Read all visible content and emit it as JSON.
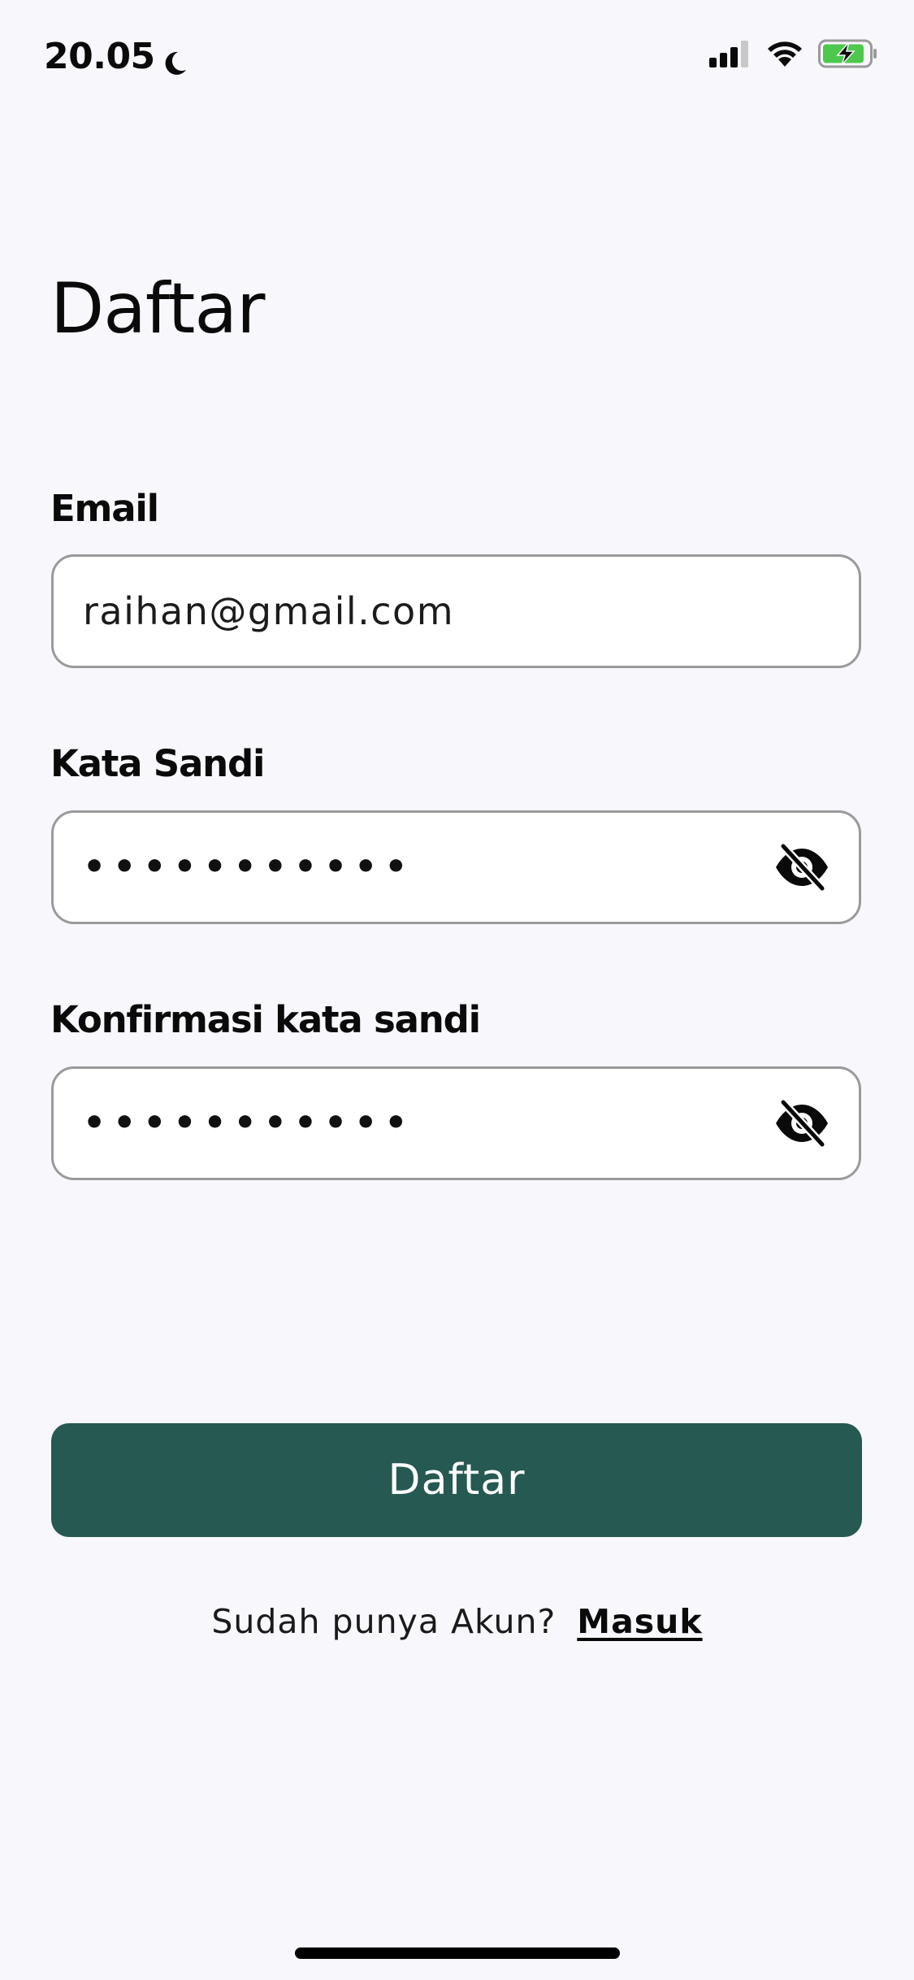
{
  "status_bar": {
    "time": "20.05",
    "icons": [
      "moon-icon",
      "signal-icon",
      "wifi-icon",
      "battery-charging-icon"
    ]
  },
  "page": {
    "title": "Daftar"
  },
  "form": {
    "email": {
      "label": "Email",
      "value": "raihan@gmail.com"
    },
    "password": {
      "label": "Kata Sandi",
      "masked_value": "•••••••••••",
      "toggle_icon": "eye-off-icon"
    },
    "confirm_password": {
      "label": "Konfirmasi kata sandi",
      "masked_value": "•••••••••••",
      "toggle_icon": "eye-off-icon"
    }
  },
  "actions": {
    "submit_label": "Daftar",
    "have_account_text": "Sudah punya Akun?",
    "login_link": "Masuk"
  },
  "colors": {
    "background": "#F7F7FC",
    "primary": "#255951",
    "input_border": "#9A9A9A",
    "battery_fill": "#4CC94C"
  }
}
